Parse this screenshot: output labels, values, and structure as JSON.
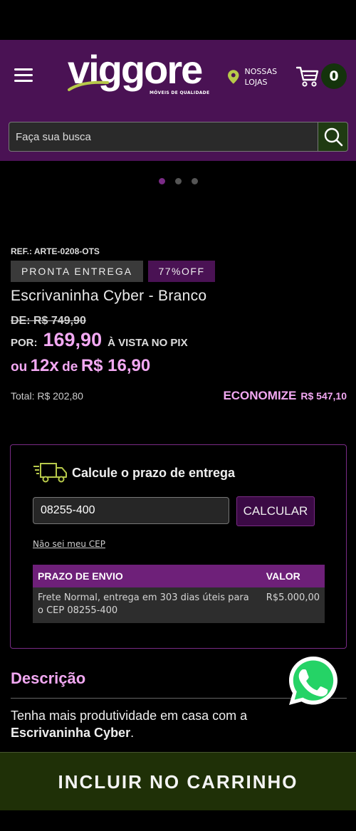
{
  "header": {
    "logo_text": "viggore",
    "logo_subtitle": "MÓVEIS DE QUALIDADE",
    "stores_label": "NOSSAS LOJAS",
    "cart_count": "0",
    "bg_color": "#4a1254"
  },
  "search": {
    "placeholder": "Faça sua busca"
  },
  "carousel": {
    "dots": 3,
    "active_index": 0
  },
  "product": {
    "ref": "REF.: ARTE-0208-OTS",
    "tag_ready": "PRONTA ENTREGA",
    "tag_discount": "77%OFF",
    "title": "Escrivaninha Cyber - Branco",
    "old_price": "DE: R$ 749,90",
    "price_prefix": "POR:",
    "price": "169,90",
    "price_suffix": "À VISTA NO PIX",
    "installment_ou": "ou",
    "installment_count": "12x",
    "installment_de": "de",
    "installment_value": "R$ 16,90",
    "total": "Total: R$ 202,80",
    "economize_label": "ECONOMIZE",
    "economize_value": "R$ 547,10",
    "highlight_color": "#f2a8f2"
  },
  "shipping": {
    "title": "Calcule o prazo de entrega",
    "cep_value": "08255-400",
    "calc_button": "CALCULAR",
    "no_cep_link": "Não sei meu CEP",
    "table_headers": [
      "PRAZO DE ENVIO",
      "VALOR"
    ],
    "rows": [
      {
        "prazo": "Frete Normal, entrega em 303 dias úteis para o CEP 08255-400",
        "valor": "R$5.000,00"
      }
    ]
  },
  "description": {
    "heading": "Descrição",
    "text_prefix": "Tenha mais produtividade em casa com a ",
    "text_bold": "Escrivaninha Cyber",
    "text_suffix": "."
  },
  "cta": {
    "add_to_cart": "INCLUIR NO CARRINHO",
    "bg_color": "#1f3007"
  },
  "icons": [
    "menu-icon",
    "location-pin-icon",
    "cart-icon",
    "search-icon",
    "truck-icon",
    "whatsapp-icon"
  ]
}
